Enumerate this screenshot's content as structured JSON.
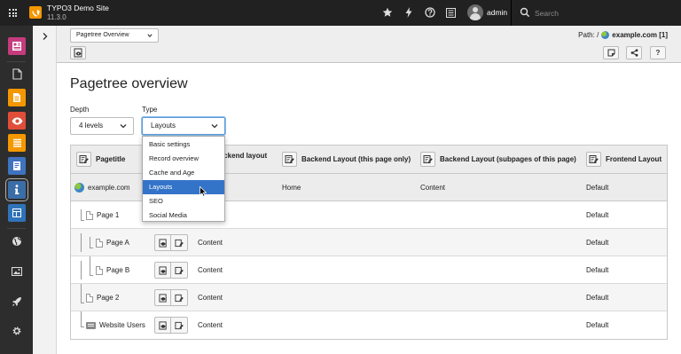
{
  "topbar": {
    "site_name": "TYPO3 Demo Site",
    "version": "11.3.0",
    "user": "admin",
    "search_placeholder": "Search",
    "icons": [
      "apps-grid-icon",
      "typo3-logo",
      "star-icon",
      "flash-icon",
      "help-icon",
      "list-icon",
      "avatar",
      "search-icon"
    ]
  },
  "module_menu": {
    "items": [
      {
        "name": "dashboard-module-icon",
        "color": "#c53b7d"
      },
      {
        "name": "page-module-icon",
        "color": "#2d2d2d"
      },
      {
        "name": "list-module-icon",
        "color": "#f49700"
      },
      {
        "name": "view-module-icon",
        "color": "#e04e39"
      },
      {
        "name": "lists-module-icon",
        "color": "#f49700"
      },
      {
        "name": "form-module-icon",
        "color": "#3f72bf"
      },
      {
        "name": "info-module-icon",
        "color": "#3b6ea8",
        "active": true
      },
      {
        "name": "template-module-icon",
        "color": "#2f73b9"
      },
      {
        "name": "globe-module-icon",
        "color": "#2d2d2d"
      },
      {
        "name": "image-module-icon",
        "color": "#2d2d2d"
      },
      {
        "name": "rocket-module-icon",
        "color": "#2d2d2d"
      },
      {
        "name": "gear-module-icon",
        "color": "#2d2d2d"
      }
    ]
  },
  "docheader": {
    "menu_select": "Pagetree Overview",
    "path_label": "Path: /",
    "path_site": "example.com [1]"
  },
  "page": {
    "title": "Pagetree overview",
    "depth_label": "Depth",
    "depth_value": "4 levels",
    "type_label": "Type",
    "type_value": "Layouts"
  },
  "type_options": [
    "Basic settings",
    "Record overview",
    "Cache and Age",
    "Layouts",
    "SEO",
    "Social Media"
  ],
  "table": {
    "headers": [
      "Pagetitle",
      "Backend layout",
      "Backend Layout (this page only)",
      "Backend Layout (subpages of this page)",
      "Frontend Layout"
    ],
    "rows": [
      {
        "title": "example.com",
        "layout": "",
        "this_page": "Home",
        "subpages": "Content",
        "frontend": "Default"
      },
      {
        "title": "Page 1",
        "layout": "",
        "this_page": "",
        "subpages": "",
        "frontend": "Default"
      },
      {
        "title": "Page A",
        "layout": "Content",
        "this_page": "",
        "subpages": "",
        "frontend": "Default"
      },
      {
        "title": "Page B",
        "layout": "Content",
        "this_page": "",
        "subpages": "",
        "frontend": "Default"
      },
      {
        "title": "Page 2",
        "layout": "Content",
        "this_page": "",
        "subpages": "",
        "frontend": "Default"
      },
      {
        "title": "Website Users",
        "layout": "Content",
        "this_page": "",
        "subpages": "",
        "frontend": "Default"
      }
    ]
  },
  "colors": {
    "topbar": "#212121",
    "module_menu": "#2d2d2d",
    "selected": "#3474c8",
    "accent": "#f49700"
  }
}
